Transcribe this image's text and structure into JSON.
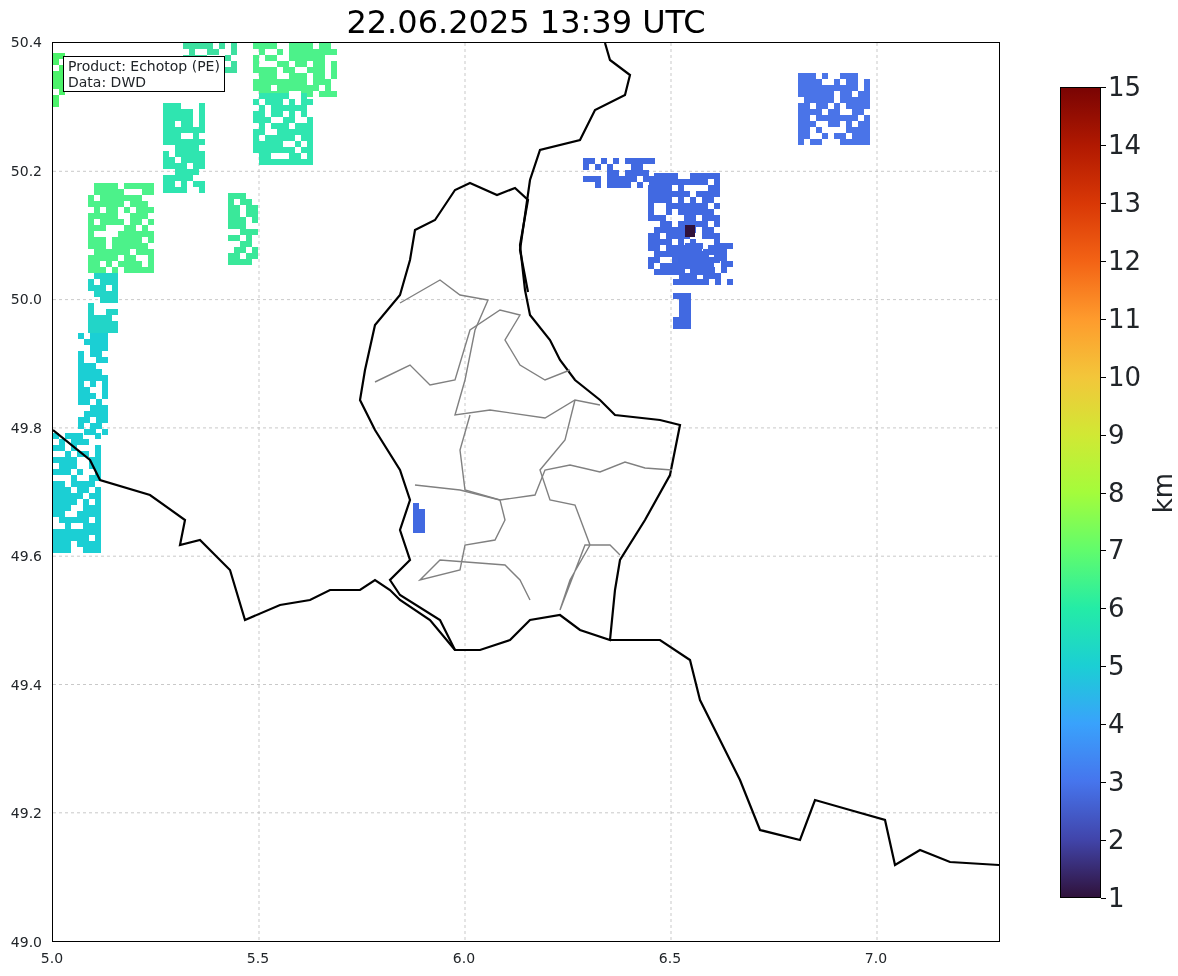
{
  "title": "22.06.2025 13:39 UTC",
  "info_box": {
    "lines": [
      "Product: Echotop (PE)",
      "Data: DWD"
    ]
  },
  "map": {
    "xticks": [
      "5.0",
      "5.5",
      "6.0",
      "6.5",
      "7.0"
    ],
    "yticks": [
      "50.4",
      "50.2",
      "50.0",
      "49.8",
      "49.6",
      "49.4",
      "49.2",
      "49.0"
    ]
  },
  "colorbar": {
    "label": "km",
    "ticks": [
      "15",
      "14",
      "13",
      "12",
      "11",
      "10",
      "9",
      "8",
      "7",
      "6",
      "5",
      "4",
      "3",
      "2",
      "1"
    ]
  }
}
